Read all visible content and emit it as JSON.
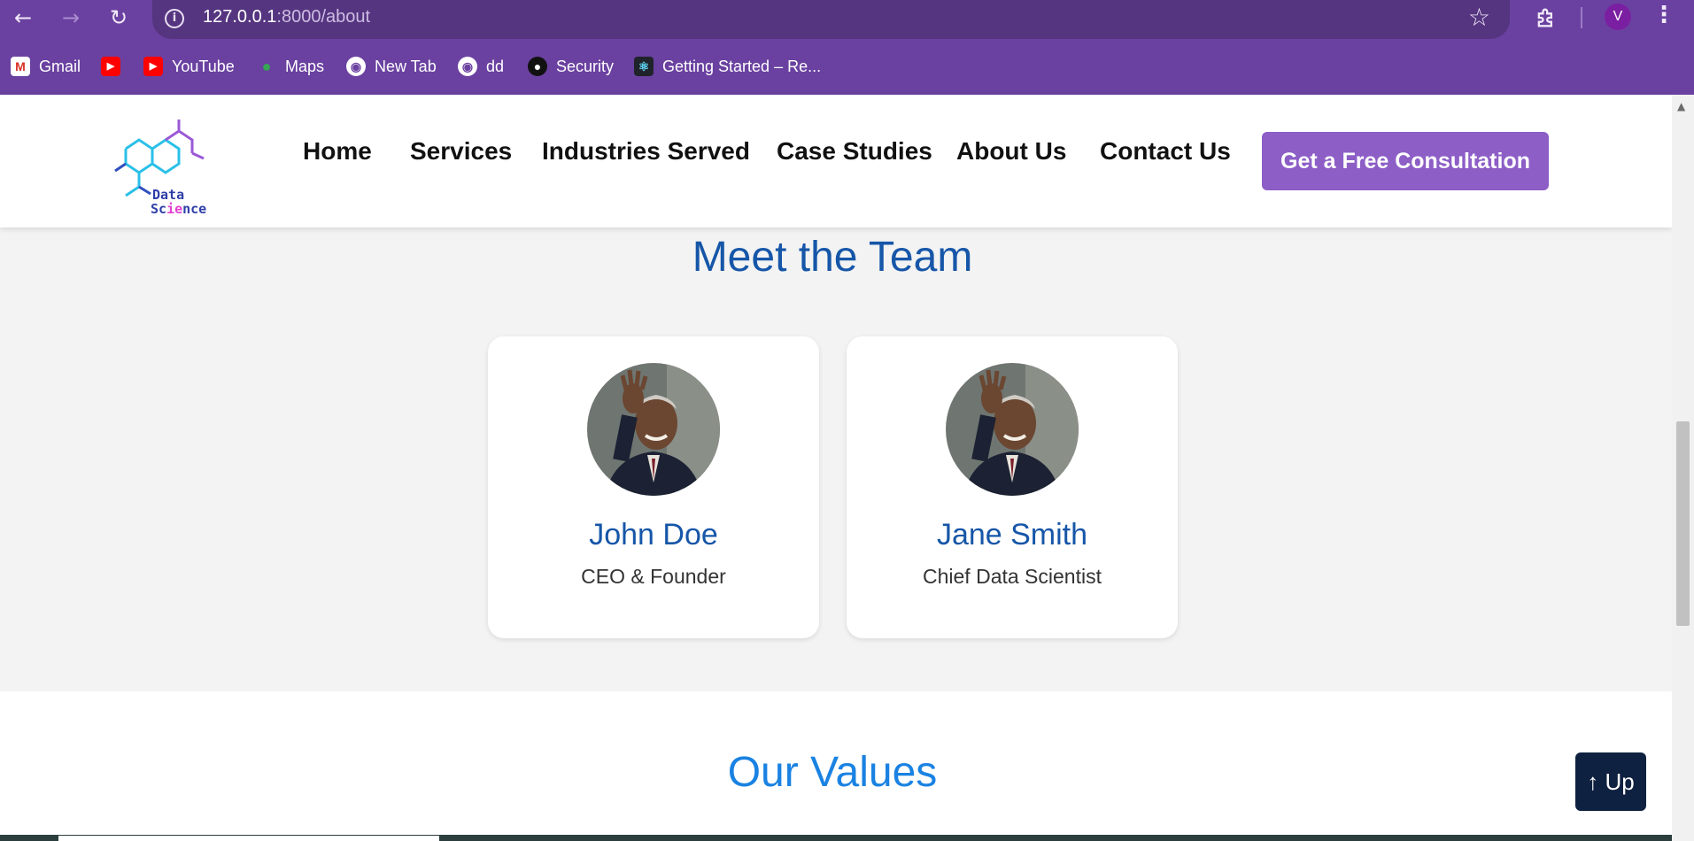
{
  "browser": {
    "url_host": "127.0.0.1",
    "url_path": ":8000/about",
    "profile_initial": "V",
    "bookmarks": [
      {
        "label": "Gmail",
        "icon": "gmail-icon"
      },
      {
        "label": "",
        "icon": "youtube-icon"
      },
      {
        "label": "YouTube",
        "icon": "youtube-icon"
      },
      {
        "label": "Maps",
        "icon": "maps-icon"
      },
      {
        "label": "New Tab",
        "icon": "globe-icon"
      },
      {
        "label": "dd",
        "icon": "globe-icon"
      },
      {
        "label": "Security",
        "icon": "github-icon"
      },
      {
        "label": "Getting Started – Re...",
        "icon": "react-icon"
      }
    ]
  },
  "header": {
    "logo_text_line1": "Data",
    "logo_text_line2": "Science",
    "nav": [
      "Home",
      "Services",
      "Industries Served",
      "Case Studies",
      "About Us",
      "Contact Us"
    ],
    "cta_label": "Get a Free Consultation"
  },
  "team": {
    "title": "Meet the Team",
    "members": [
      {
        "name": "John Doe",
        "role": "CEO & Founder"
      },
      {
        "name": "Jane Smith",
        "role": "Chief Data Scientist"
      }
    ]
  },
  "values": {
    "title": "Our Values"
  },
  "up_button_label": "↑ Up",
  "colors": {
    "chrome": "#6a41a0",
    "cta": "#8c5ec6",
    "team_title": "#1656a8",
    "values_title": "#1a82e2",
    "up_button": "#0f2140"
  }
}
